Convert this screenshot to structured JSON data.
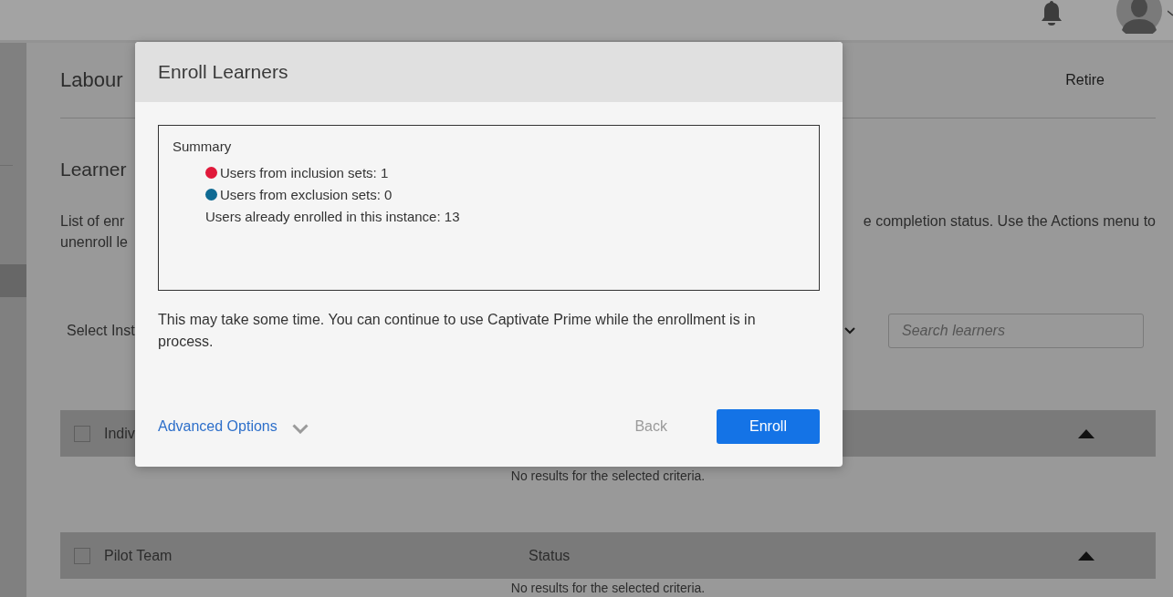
{
  "page": {
    "title": "Labour",
    "action": "Retire",
    "section_title": "Learner",
    "description_left": [
      "List of enr",
      "unenroll le"
    ],
    "description_right": "e completion status. Use the Actions menu to",
    "instance_select": {
      "label": "Select Inst"
    },
    "search": {
      "placeholder": "Search learners"
    },
    "groups": [
      {
        "name": "Indiv",
        "checked": false,
        "empty_text": "No results for the selected criteria."
      },
      {
        "name": "Pilot Team",
        "column_2": "Status",
        "checked": false,
        "empty_text": "No results for the selected criteria."
      }
    ]
  },
  "dialog": {
    "title": "Enroll Learners",
    "summary": {
      "heading": "Summary",
      "items": [
        {
          "text": "Users from inclusion sets: 1",
          "color": "#e0193a"
        },
        {
          "text": "Users from exclusion sets: 0",
          "color": "#0f6a93"
        },
        {
          "text": "Users already enrolled in this instance: 13"
        }
      ]
    },
    "note": "This may take some time. You can continue to use Captivate Prime while the enrollment is in process.",
    "advanced_options": {
      "label": "Advanced Options",
      "expanded": false
    },
    "buttons": [
      {
        "label": "Back",
        "kind": "secondary",
        "disabled": true
      },
      {
        "label": "Enroll",
        "kind": "primary",
        "disabled": false
      }
    ]
  }
}
